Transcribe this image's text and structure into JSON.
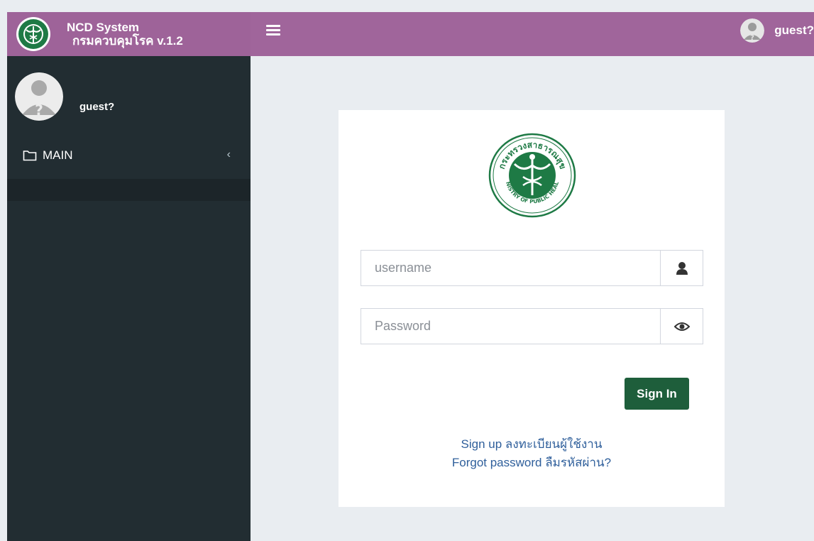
{
  "brand": {
    "title": "NCD System",
    "subtitle": "กรมควบคุมโรค  v.1.2",
    "seal_ring_text": "กระทรวงสาธารณสุข",
    "seal_bottom_text": "MINISTRY OF PUBLIC HEALTH",
    "color": "#9e6399",
    "seal_color": "#1e7a45"
  },
  "header": {
    "user_name": "guest?"
  },
  "sidebar": {
    "user_name": "guest?",
    "menu": [
      {
        "label": "MAIN",
        "icon": "folder-icon"
      }
    ]
  },
  "login": {
    "username_placeholder": "username",
    "password_placeholder": "Password",
    "signin_label": "Sign In",
    "signup_link": "Sign up ลงทะเบียนผู้ใช้งาน",
    "forgot_link": "Forgot password ลืมรหัสผ่าน?",
    "button_color": "#1e5e3b"
  }
}
